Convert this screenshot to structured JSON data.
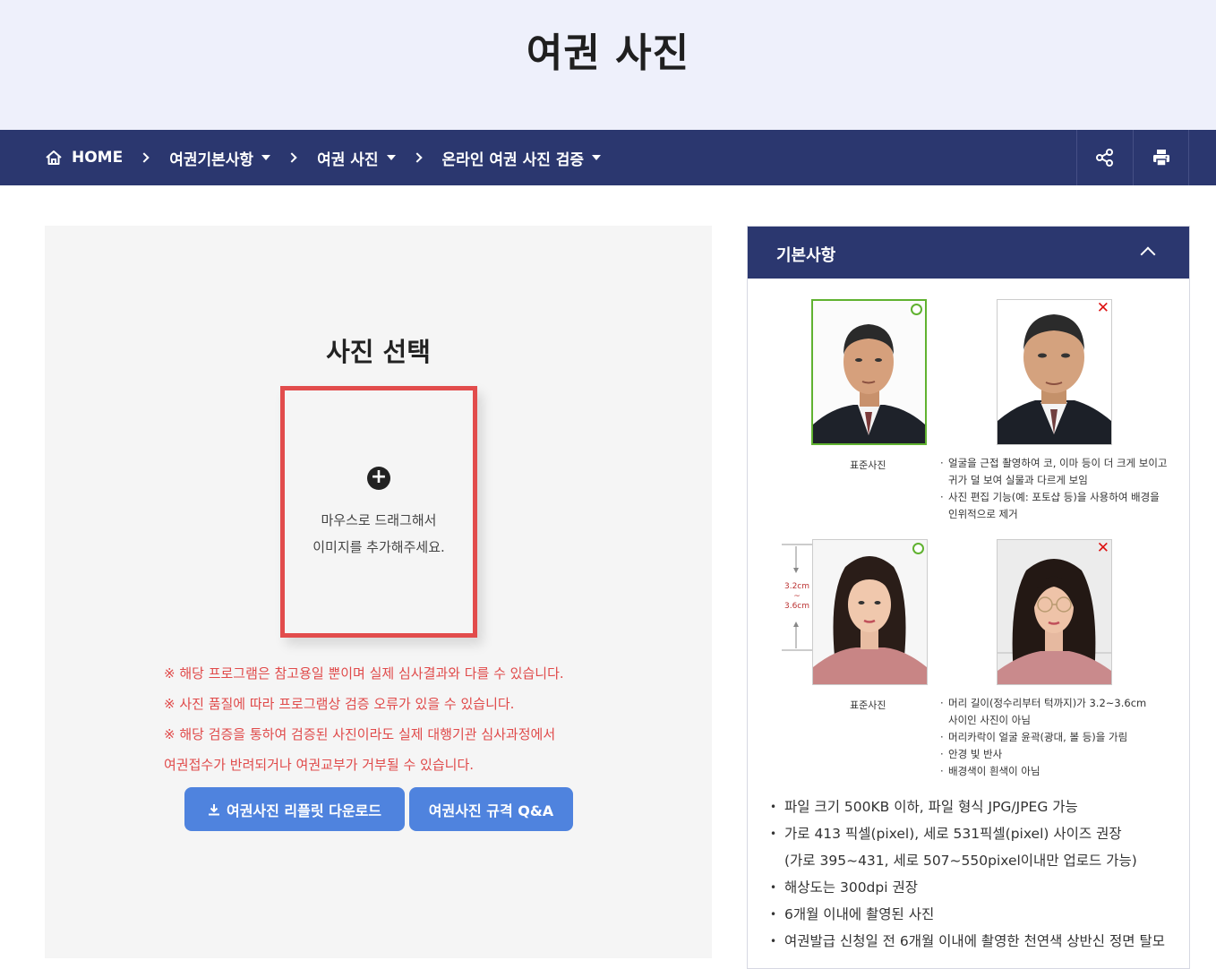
{
  "page": {
    "title": "여권 사진"
  },
  "breadcrumb": {
    "home": "HOME",
    "item1": "여권기본사항",
    "item2": "여권 사진",
    "item3": "온라인 여권 사진 검증"
  },
  "upload": {
    "heading": "사진 선택",
    "line1": "마우스로 드래그해서",
    "line2": "이미지를 추가해주세요."
  },
  "notices": [
    "※ 해당 프로그램은 참고용일 뿐이며 실제 심사결과와 다를 수 있습니다.",
    "※ 사진 품질에 따라 프로그램상 검증 오류가 있을 수 있습니다.",
    "※ 해당 검증을 통하여 검증된 사진이라도 실제 대행기관 심사과정에서",
    "여권접수가 반려되거나 여권교부가 거부될 수 있습니다."
  ],
  "buttons": {
    "download": "여권사진 리플릿 다운로드",
    "qa": "여권사진 규격 Q&A"
  },
  "sidebar": {
    "title": "기본사항",
    "example1": {
      "caption": "표준사진",
      "notes": [
        "얼굴을 근접 촬영하여 코, 이마 등이 더 크게 보이고",
        "귀가 덜 보여 실물과 다르게 보임",
        "사진 편집 기능(예: 포토샵 등)을 사용하여 배경을",
        "인위적으로 제거"
      ]
    },
    "example2": {
      "caption": "표준사진",
      "measure_top": "3.2cm",
      "measure_mid": "~",
      "measure_bottom": "3.6cm",
      "notes": [
        "머리 길이(정수리부터 턱까지)가 3.2~3.6cm",
        "사이인 사진이 아님",
        "머리카락이 얼굴 윤곽(광대, 볼 등)을 가림",
        "안경 빛 반사",
        "배경색이 흰색이 아님"
      ]
    },
    "requirements": [
      "파일 크기 500KB 이하, 파일 형식 JPG/JPEG 가능",
      "가로 413 픽셀(pixel), 세로 531픽셀(pixel) 사이즈 권장",
      "(가로 395~431, 세로 507~550pixel이내만 업로드 가능)",
      "해상도는 300dpi 권장",
      "6개월 이내에 촬영된 사진",
      "여권발급 신청일 전 6개월 이내에 촬영한 천연색 상반신 정면 탈모"
    ]
  },
  "colors": {
    "navy": "#2b376f",
    "hero_bg": "#eef0fb",
    "accent_red": "#e24c4c",
    "button_blue": "#4f83de",
    "good_green": "#60b230"
  },
  "icons": {
    "home": "home-icon",
    "share": "share-icon",
    "print": "print-icon",
    "plus": "plus-circle-icon",
    "download": "download-icon",
    "collapse": "chevron-up-icon",
    "good": "circle-mark-icon",
    "bad": "x-mark-icon"
  }
}
